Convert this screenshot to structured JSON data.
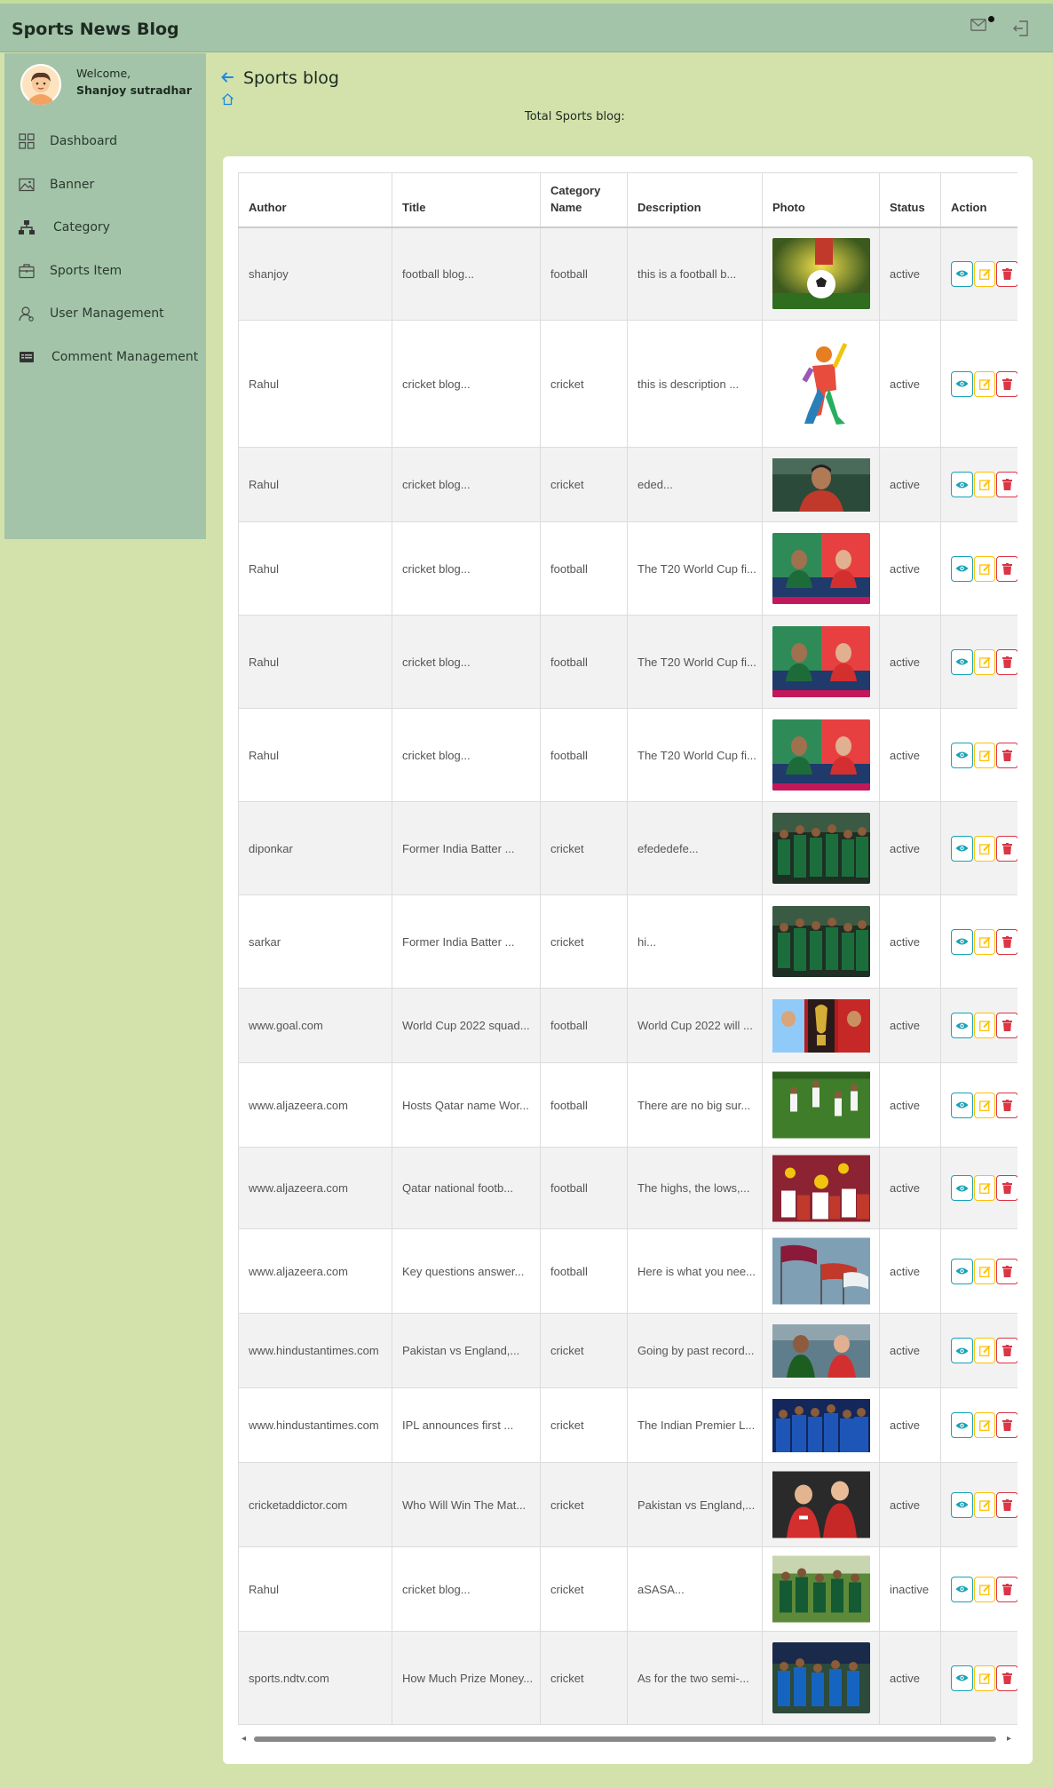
{
  "app": {
    "title": "Sports News Blog"
  },
  "user": {
    "welcome": "Welcome,",
    "name": "Shanjoy sutradhar"
  },
  "sidebar": {
    "items": [
      {
        "label": "Dashboard",
        "icon": "dashboard-grid-icon"
      },
      {
        "label": "Banner",
        "icon": "image-icon"
      },
      {
        "label": "Category",
        "icon": "sitemap-icon"
      },
      {
        "label": "Sports Item",
        "icon": "briefcase-icon"
      },
      {
        "label": "User Management",
        "icon": "user-icon"
      },
      {
        "label": "Comment Management",
        "icon": "comment-card-icon"
      }
    ]
  },
  "page": {
    "title": "Sports blog",
    "total_label": "Total Sports blog:"
  },
  "table": {
    "headers": [
      "Author",
      "Title",
      "Category Name",
      "Description",
      "Photo",
      "Status",
      "Action"
    ],
    "rows": [
      {
        "author": "shanjoy",
        "title": "football blog...",
        "category": "football",
        "description": "this is a football b...",
        "status": "active",
        "photo": "football-ball"
      },
      {
        "author": "Rahul",
        "title": "cricket blog...",
        "category": "cricket",
        "description": "this is description ...",
        "status": "active",
        "photo": "cricket-batter-art"
      },
      {
        "author": "Rahul",
        "title": "cricket blog...",
        "category": "cricket",
        "description": "eded...",
        "status": "active",
        "photo": "cricket-player-portrait"
      },
      {
        "author": "Rahul",
        "title": "cricket blog...",
        "category": "football",
        "description": "The T20 World Cup fi...",
        "status": "active",
        "photo": "t20-captains"
      },
      {
        "author": "Rahul",
        "title": "cricket blog...",
        "category": "football",
        "description": "The T20 World Cup fi...",
        "status": "active",
        "photo": "t20-captains"
      },
      {
        "author": "Rahul",
        "title": "cricket blog...",
        "category": "football",
        "description": "The T20 World Cup fi...",
        "status": "active",
        "photo": "t20-captains"
      },
      {
        "author": "diponkar",
        "title": "Former India Batter ...",
        "category": "cricket",
        "description": "efededefe...",
        "status": "active",
        "photo": "team-green"
      },
      {
        "author": "sarkar",
        "title": "Former India Batter ...",
        "category": "cricket",
        "description": "hi...",
        "status": "active",
        "photo": "team-green"
      },
      {
        "author": "www.goal.com",
        "title": "World Cup 2022 squad...",
        "category": "football",
        "description": "World Cup 2022 will ...",
        "status": "active",
        "photo": "world-cup-trophy"
      },
      {
        "author": "www.aljazeera.com",
        "title": "Hosts Qatar name Wor...",
        "category": "football",
        "description": "There are no big sur...",
        "status": "active",
        "photo": "football-pitch"
      },
      {
        "author": "www.aljazeera.com",
        "title": "Qatar national footb...",
        "category": "football",
        "description": "The highs, the lows,...",
        "status": "active",
        "photo": "football-crowd"
      },
      {
        "author": "www.aljazeera.com",
        "title": "Key questions answer...",
        "category": "football",
        "description": "Here is what you nee...",
        "status": "active",
        "photo": "flags"
      },
      {
        "author": "www.hindustantimes.com",
        "title": "Pakistan vs England,...",
        "category": "cricket",
        "description": "Going by past record...",
        "status": "active",
        "photo": "pak-eng-captains"
      },
      {
        "author": "www.hindustantimes.com",
        "title": "IPL announces first ...",
        "category": "cricket",
        "description": "The Indian Premier L...",
        "status": "active",
        "photo": "team-blue"
      },
      {
        "author": "cricketaddictor.com",
        "title": "Who Will Win The Mat...",
        "category": "cricket",
        "description": "Pakistan vs England,...",
        "status": "active",
        "photo": "england-players"
      },
      {
        "author": "Rahul",
        "title": "cricket blog...",
        "category": "cricket",
        "description": "aSASA...",
        "status": "inactive",
        "photo": "team-green-field"
      },
      {
        "author": "sports.ndtv.com",
        "title": "How Much Prize Money...",
        "category": "cricket",
        "description": "As for the two semi-...",
        "status": "active",
        "photo": "team-blue-field"
      }
    ]
  },
  "colors": {
    "page_bg": "#d2e2aa",
    "sidebar_bg": "#a3c4a8",
    "view": "#17a2b8",
    "edit": "#ffc107",
    "delete": "#dc3545",
    "back": "#1e88e5"
  }
}
